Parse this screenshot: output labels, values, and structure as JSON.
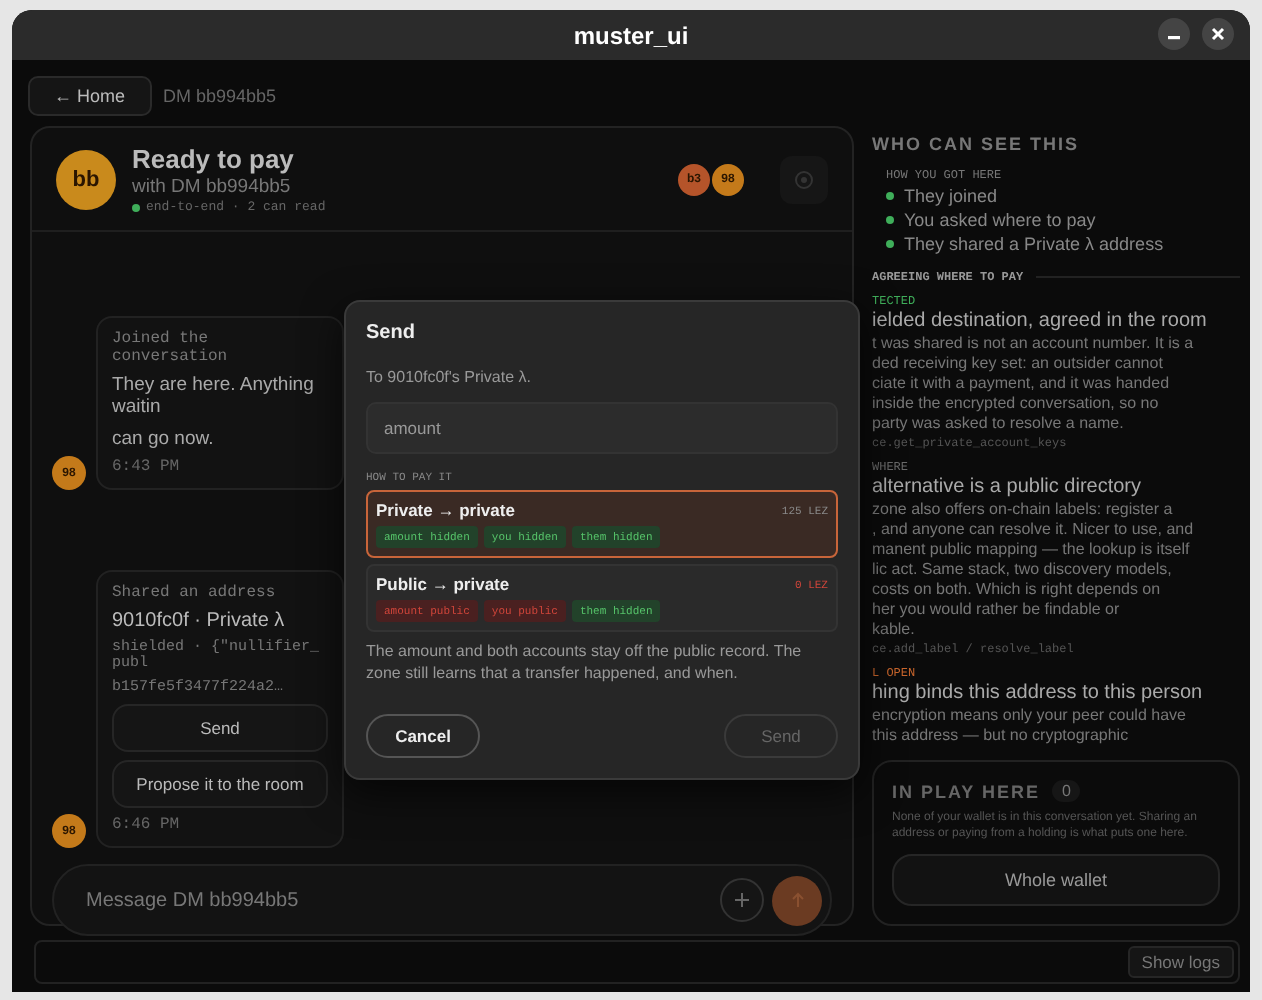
{
  "window": {
    "title": "muster_ui"
  },
  "nav": {
    "home_button": "← Home",
    "breadcrumb": "DM bb994bb5"
  },
  "chat": {
    "header": {
      "avatar": {
        "initials": "bb",
        "color": "#c98a1c"
      },
      "title": "Ready to pay",
      "subtitle": "with DM bb994bb5",
      "status": "end-to-end · 2 can read",
      "readers": [
        {
          "initials": "b3",
          "color": "#b5542a"
        },
        {
          "initials": "98",
          "color": "#c47a1a"
        }
      ]
    },
    "messages": [
      {
        "kind": "text",
        "avatar": {
          "initials": "98",
          "color": "#c47a1a"
        },
        "heading": "Joined the conversation",
        "lines": [
          "They are here. Anything waitin",
          "can go now."
        ],
        "time": "6:43 PM"
      },
      {
        "kind": "address",
        "avatar": {
          "initials": "98",
          "color": "#c47a1a"
        },
        "heading": "Shared an address",
        "title": "9010fc0f · Private λ",
        "code_lines": [
          "shielded · {\"nullifier_publ",
          "b157fe5f3477f224a2…"
        ],
        "buttons": [
          "Send",
          "Propose it to the room"
        ],
        "time": "6:46 PM"
      }
    ],
    "composer": {
      "placeholder": "Message DM bb994bb5"
    }
  },
  "side": {
    "title": "WHO CAN SEE THIS",
    "history_label": "HOW YOU GOT HERE",
    "history": [
      "They joined",
      "You asked where to pay",
      "They shared a Private λ address"
    ],
    "agreeing_label": "AGREEING WHERE TO PAY",
    "notes": [
      {
        "tag": "TECTED",
        "color": "#3fae5a",
        "heading": "ielded destination, agreed in the room",
        "lines": [
          "t was shared is not an account number. It is a",
          "ded receiving key set: an outsider cannot",
          "ciate it with a payment, and it was handed",
          "inside the encrypted conversation, so no",
          "party was asked to resolve a name."
        ],
        "code": "ce.get_private_account_keys"
      },
      {
        "tag": "WHERE",
        "color": "#6a6a6a",
        "heading": "alternative is a public directory",
        "lines": [
          "zone also offers on-chain labels: register a",
          ", and anyone can resolve it. Nicer to use, and",
          "manent public mapping — the lookup is itself",
          "lic act. Same stack, two discovery models,",
          "costs on both. Which is right depends on",
          "her you would rather be findable or",
          "kable."
        ],
        "code": "ce.add_label / resolve_label"
      },
      {
        "tag": "L OPEN",
        "color": "#c8652c",
        "heading": "hing binds this address to this person",
        "lines": [
          "encryption means only your peer could have",
          "this address — but no cryptographic"
        ]
      }
    ],
    "in_play": {
      "title": "IN PLAY HERE",
      "count": "0",
      "description": "None of your wallet is in this conversation yet. Sharing an address or paying from a holding is what puts one here.",
      "button": "Whole wallet"
    }
  },
  "status_bar": {
    "button": "Show logs"
  },
  "dialog": {
    "title": "Send",
    "recipient": "To 9010fc0f's Private λ.",
    "amount": {
      "placeholder": "amount"
    },
    "options_label": "HOW TO PAY IT",
    "options": [
      {
        "label": "Private → private",
        "price": "125 LEZ",
        "color": "#8a8a8a",
        "selected": true,
        "tags": [
          {
            "label": "amount hidden",
            "kind": "hidden"
          },
          {
            "label": "you hidden",
            "kind": "hidden"
          },
          {
            "label": "them hidden",
            "kind": "hidden"
          }
        ]
      },
      {
        "label": "Public → private",
        "price": "0 LEZ",
        "color": "#d0453a",
        "selected": false,
        "tags": [
          {
            "label": "amount public",
            "kind": "public"
          },
          {
            "label": "you public",
            "kind": "public"
          },
          {
            "label": "them hidden",
            "kind": "hidden"
          }
        ]
      }
    ],
    "description": "The amount and both accounts stay off the public record. The zone still learns that a transfer happened, and when.",
    "cancel": "Cancel",
    "confirm": {
      "label": "Send",
      "disabled": true
    }
  }
}
